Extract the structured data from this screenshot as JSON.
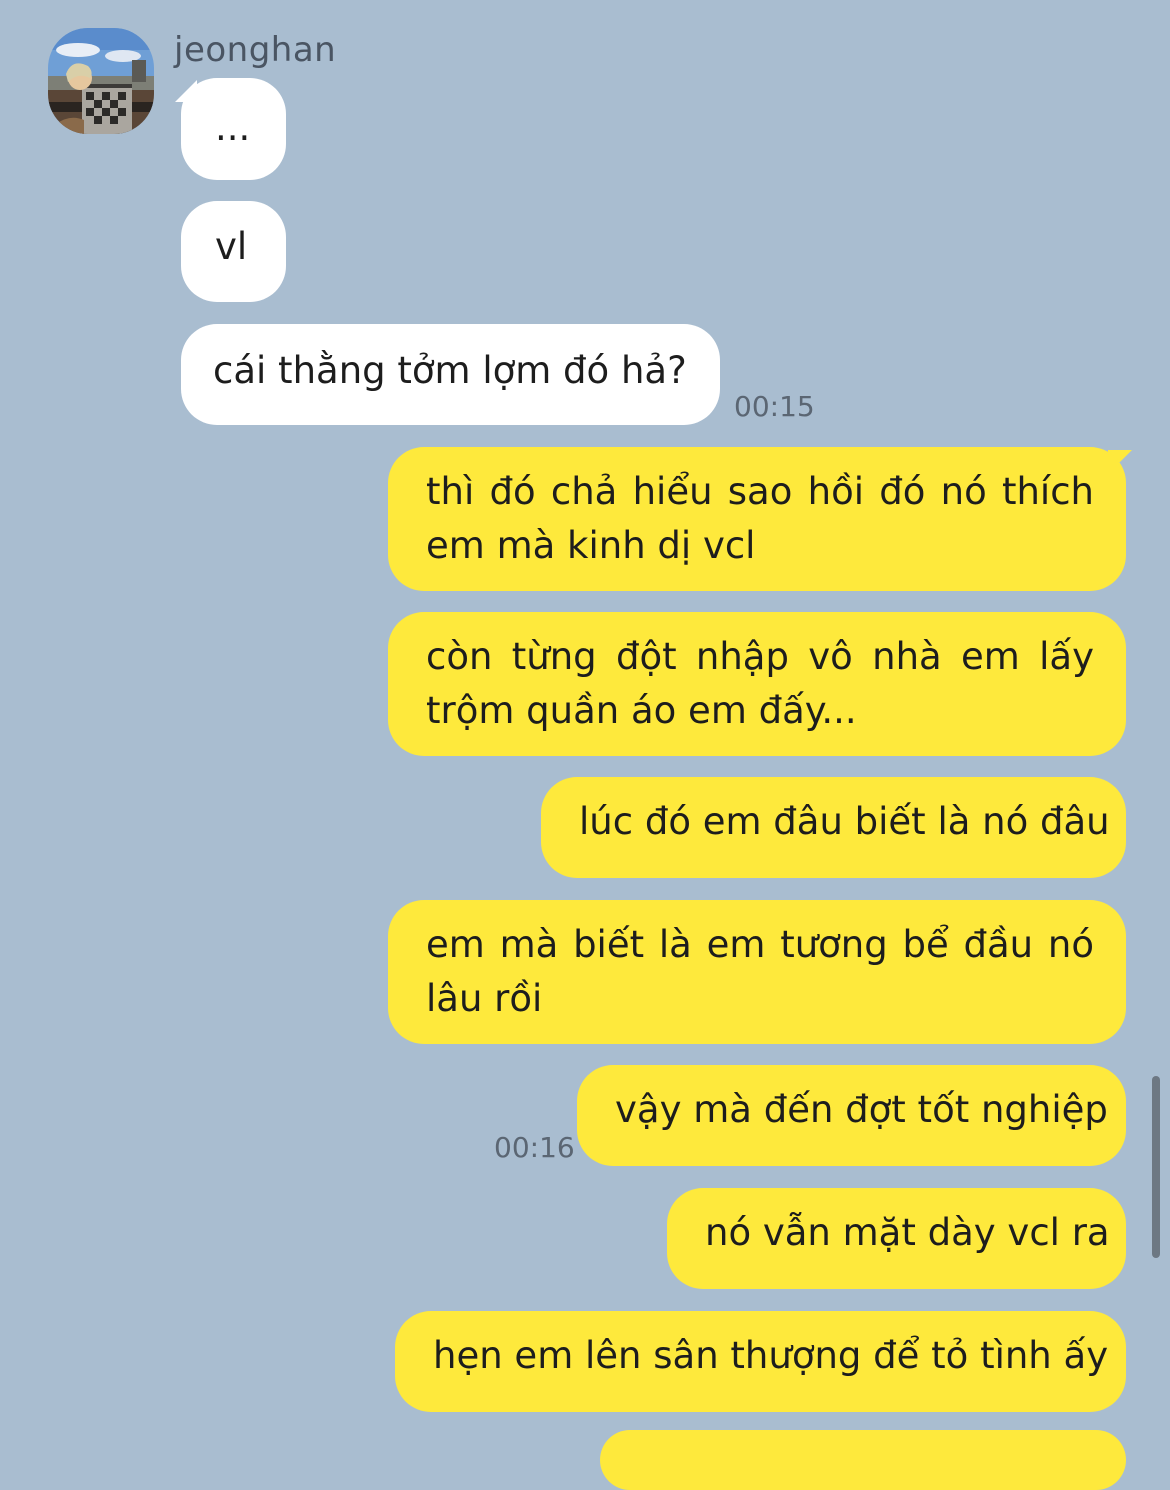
{
  "sender": {
    "name": "jeonghan"
  },
  "messages": [
    {
      "text": "..."
    },
    {
      "text": "vl"
    },
    {
      "text": "cái thằng tởm lợm đó hả?",
      "time": "00:15"
    },
    {
      "text": "thì đó chả hiểu sao hồi đó nó thích em mà kinh dị vcl"
    },
    {
      "text": "còn từng đột nhập vô nhà em lấy trộm quần áo em đấy..."
    },
    {
      "text": "lúc đó em đâu biết là nó đâu"
    },
    {
      "text": "em mà biết là em tương bể đầu nó lâu rồi"
    },
    {
      "text": "vậy mà đến đợt tốt nghiệp",
      "time": "00:16"
    },
    {
      "text": "nó vẫn mặt dày vcl ra"
    },
    {
      "text": "hẹn em lên sân thượng để tỏ tình ấy"
    }
  ],
  "colors": {
    "background": "#a9bdd0",
    "incoming_bubble": "#ffffff",
    "outgoing_bubble": "#fee93c"
  }
}
